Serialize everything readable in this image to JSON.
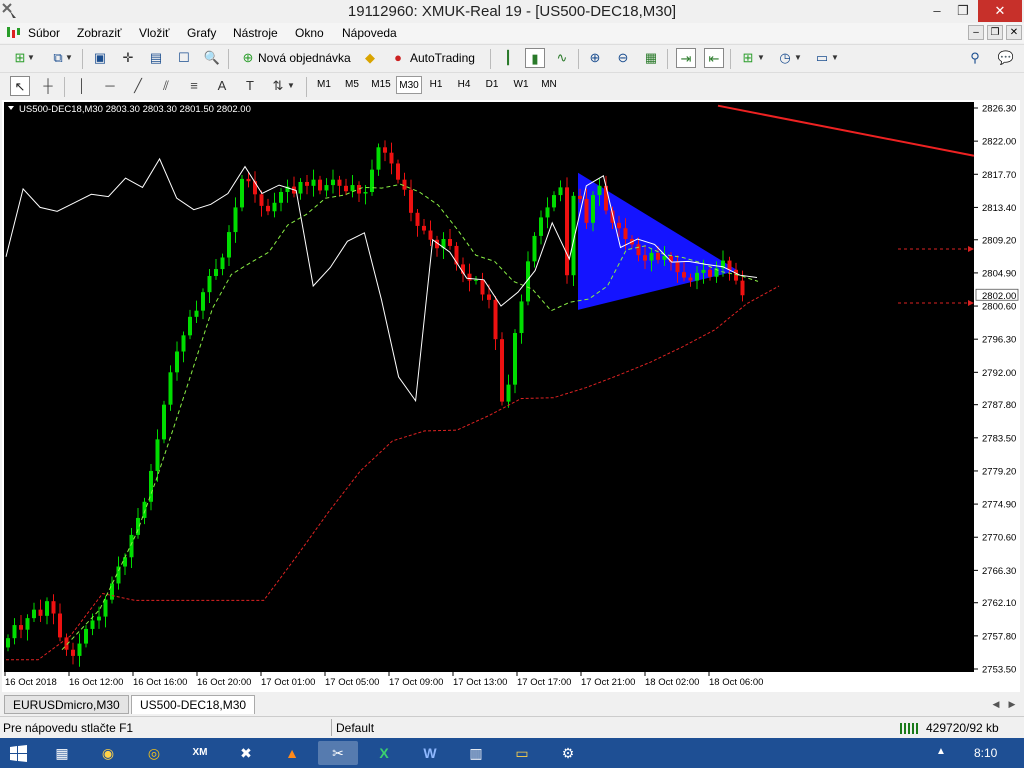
{
  "window": {
    "title": "19112960: XMUK-Real 19 - [US500-DEC18,M30]",
    "controls": [
      "–",
      "❐",
      "✕"
    ]
  },
  "menu": [
    "Súbor",
    "Zobraziť",
    "Vložiť",
    "Grafy",
    "Nástroje",
    "Okno",
    "Nápoveda"
  ],
  "toolbar": {
    "new_order_label": "Nová objednávka",
    "autotrading_label": "AutoTrading"
  },
  "timeframes": [
    "M1",
    "M5",
    "M15",
    "M30",
    "H1",
    "H4",
    "D1",
    "W1",
    "MN"
  ],
  "active_timeframe": "M30",
  "chart_header": "US500-DEC18,M30  2803.30 2803.30 2801.50 2802.00",
  "chart_data": {
    "type": "candlestick",
    "symbol": "US500-DEC18,M30",
    "ohlc_header": "2803.30 2803.30 2801.50 2802.00",
    "y_ticks": [
      "2826.30",
      "2822.00",
      "2817.70",
      "2813.40",
      "2809.20",
      "2804.90",
      "2800.60",
      "2796.30",
      "2792.00",
      "2787.80",
      "2783.50",
      "2779.20",
      "2774.90",
      "2770.60",
      "2766.30",
      "2762.10",
      "2757.80",
      "2753.50"
    ],
    "y_range": [
      2753.5,
      2826.3
    ],
    "x_ticks": [
      "16 Oct 2018",
      "16 Oct 12:00",
      "16 Oct 16:00",
      "16 Oct 20:00",
      "17 Oct 01:00",
      "17 Oct 05:00",
      "17 Oct 09:00",
      "17 Oct 13:00",
      "17 Oct 17:00",
      "17 Oct 21:00",
      "18 Oct 02:00",
      "18 Oct 06:00"
    ],
    "current_price": "2802.00",
    "colors": {
      "background": "#000000",
      "bull": "#00dd00",
      "bear": "#ee1111",
      "triangle": "#1414ff",
      "trend_line": "#ee2222",
      "fast_line": "#ffffff",
      "slow_line": "#88ee44",
      "stop_line": "#dd2222"
    },
    "closes": [
      2757.5,
      2759.2,
      2758.6,
      2760.1,
      2761.2,
      2760.4,
      2762.3,
      2760.7,
      2757.6,
      2756.0,
      2755.2,
      2756.8,
      2758.7,
      2759.8,
      2760.3,
      2762.5,
      2764.6,
      2766.8,
      2768.0,
      2770.9,
      2773.1,
      2775.2,
      2779.2,
      2783.3,
      2787.8,
      2792.0,
      2794.7,
      2796.8,
      2799.2,
      2800.0,
      2802.4,
      2804.5,
      2805.4,
      2806.9,
      2810.2,
      2813.4,
      2817.1,
      2816.8,
      2815.1,
      2813.6,
      2812.9,
      2814.0,
      2815.4,
      2816.1,
      2815.2,
      2816.7,
      2816.2,
      2817.0,
      2815.6,
      2816.3,
      2817.0,
      2816.2,
      2815.5,
      2816.3,
      2815.2,
      2815.4,
      2818.3,
      2821.2,
      2820.5,
      2819.1,
      2817.0,
      2815.7,
      2812.7,
      2811.0,
      2810.4,
      2809.2,
      2808.1,
      2809.3,
      2808.4,
      2806.0,
      2804.8,
      2803.9,
      2804.0,
      2802.1,
      2801.4,
      2796.3,
      2788.2,
      2790.4,
      2797.1,
      2801.2,
      2806.4,
      2809.7,
      2812.1,
      2813.4,
      2815.0,
      2816.0,
      2804.6,
      2814.9,
      2814.5,
      2811.4,
      2815.0,
      2816.2,
      2813.0,
      2811.4,
      2810.7,
      2809.3,
      2808.6,
      2807.2,
      2806.5,
      2807.5,
      2806.6,
      2807.1,
      2806.3,
      2805.0,
      2804.3,
      2803.9,
      2804.9,
      2805.3,
      2804.4,
      2805.5,
      2806.5,
      2805.3,
      2803.9,
      2802.0
    ],
    "fast_line": [
      2807.0,
      2815.8,
      2813.4,
      2812.9,
      2814.0,
      2815.1,
      2814.8,
      2817.2,
      2816.0,
      2819.7,
      2814.6,
      2813.1,
      2813.8,
      2815.2,
      2818.7,
      2815.2,
      2816.3,
      2815.6,
      2803.2,
      2805.6,
      2809.0,
      2810.1,
      2801.4,
      2791.4,
      2788.3,
      2809.2,
      2807.6,
      2804.2,
      2804.0,
      2800.6,
      2802.4,
      2805.2,
      2811.4,
      2806.7,
      2816.2,
      2817.5,
      2808.2,
      2809.3,
      2808.6,
      2806.3,
      2806.4,
      2806.0,
      2805.7,
      2804.6,
      2804.3
    ],
    "slow_line": [
      2756.0,
      2758.6,
      2761.2,
      2766.2,
      2771.3,
      2778.0,
      2785.3,
      2792.8,
      2800.3,
      2804.7,
      2806.2,
      2807.6,
      2811.1,
      2812.5,
      2814.6,
      2815.0,
      2816.0,
      2815.9,
      2816.4,
      2815.4,
      2813.7,
      2810.6,
      2807.2,
      2806.4,
      2803.8,
      2802.8,
      2800.0,
      2801.1,
      2801.5,
      2803.2,
      2807.9,
      2808.4,
      2807.3,
      2806.9,
      2806.2,
      2805.1,
      2804.6,
      2803.8
    ],
    "stop_line": [
      2754.7,
      2754.7,
      2757.8,
      2763.3,
      2762.4,
      2762.4,
      2762.4,
      2762.4,
      2762.4,
      2768.0,
      2773.8,
      2779.2,
      2783.1,
      2784.4,
      2784.5,
      2786.4,
      2788.6,
      2788.7,
      2790.0,
      2791.6,
      2793.3,
      2795.3,
      2797.5,
      2800.9,
      2803.2
    ]
  },
  "tabs": [
    "EURUSDmicro,M30",
    "US500-DEC18,M30"
  ],
  "active_tab": "US500-DEC18,M30",
  "status": {
    "help": "Pre nápovedu stlačte F1",
    "profile": "Default",
    "traffic": "429720/92 kb"
  },
  "taskbar": {
    "time": "8:10"
  }
}
